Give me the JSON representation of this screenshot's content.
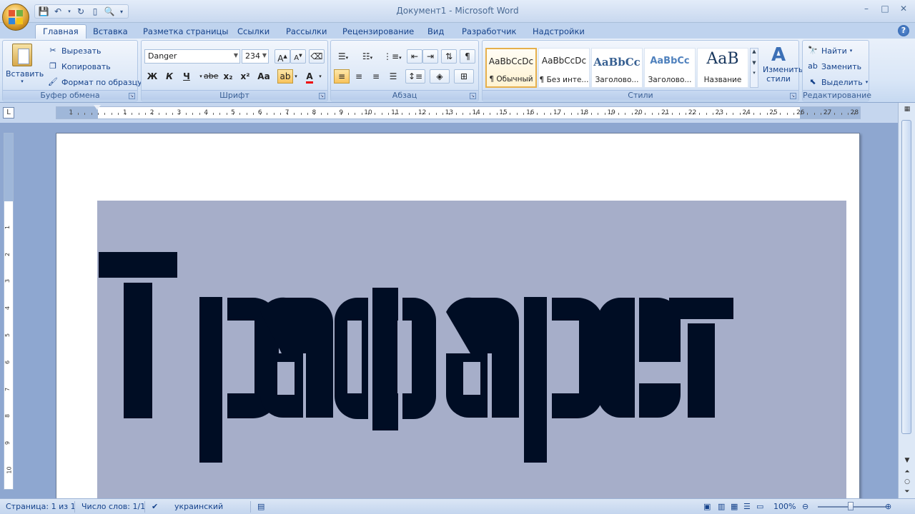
{
  "window": {
    "title": "Документ1 - Microsoft Word"
  },
  "tabs": [
    {
      "label": "Главная",
      "active": true
    },
    {
      "label": "Вставка"
    },
    {
      "label": "Разметка страницы"
    },
    {
      "label": "Ссылки"
    },
    {
      "label": "Рассылки"
    },
    {
      "label": "Рецензирование"
    },
    {
      "label": "Вид"
    },
    {
      "label": "Разработчик"
    },
    {
      "label": "Надстройки"
    }
  ],
  "ribbon": {
    "clipboard": {
      "label": "Буфер обмена",
      "paste": "Вставить",
      "cut": "Вырезать",
      "copy": "Копировать",
      "format_painter": "Формат по образцу"
    },
    "font": {
      "label": "Шрифт",
      "font_name": "Danger",
      "font_size": "234",
      "bold": "Ж",
      "italic": "К",
      "underline": "Ч",
      "strike": "abe",
      "subscript": "x₂",
      "superscript": "x²",
      "change_case": "Aa"
    },
    "paragraph": {
      "label": "Абзац"
    },
    "styles": {
      "label": "Стили",
      "items": [
        {
          "sample": "AaBbCcDc",
          "name": "¶ Обычный",
          "selected": true
        },
        {
          "sample": "AaBbCcDc",
          "name": "¶ Без инте..."
        },
        {
          "sample": "AaBbCc",
          "name": "Заголово..."
        },
        {
          "sample": "AaBbCc",
          "name": "Заголово..."
        },
        {
          "sample": "AaB",
          "name": "Название"
        }
      ],
      "change_styles": "Изменить стили"
    },
    "editing": {
      "label": "Редактирование",
      "find": "Найти",
      "replace": "Заменить",
      "select": "Выделить"
    }
  },
  "document": {
    "text": "Трафарет",
    "shading_color": "#a6aec9",
    "text_color": "#000d24"
  },
  "statusbar": {
    "page": "Страница: 1 из 1",
    "words": "Число слов: 1/1",
    "language": "украинский",
    "zoom": "100%"
  }
}
